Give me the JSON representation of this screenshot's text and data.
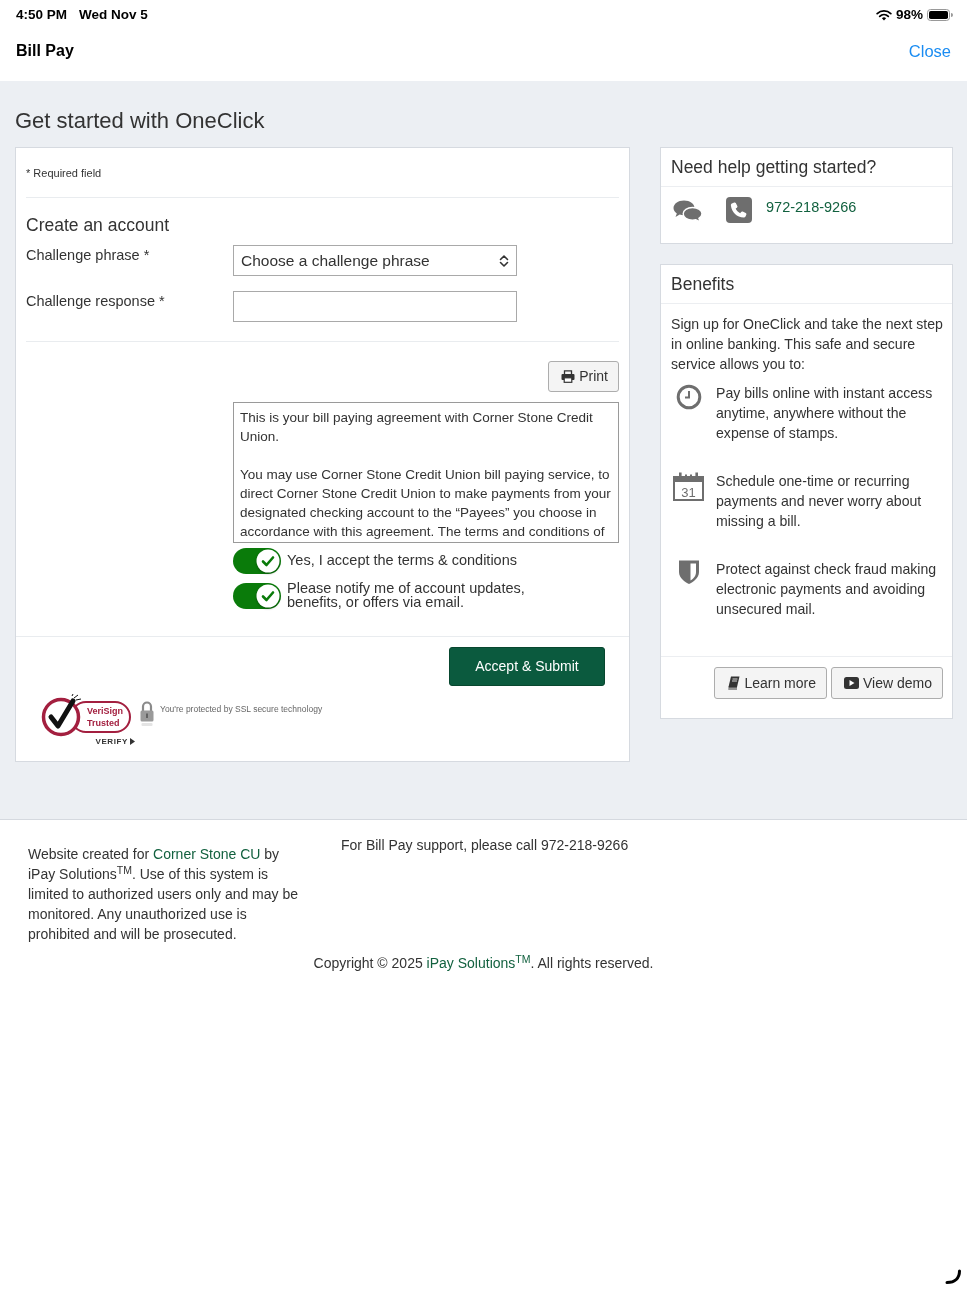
{
  "status_bar": {
    "time": "4:50 PM",
    "date": "Wed Nov 5",
    "battery": "98%"
  },
  "header": {
    "title": "Bill Pay",
    "close": "Close"
  },
  "page_title": "Get started with OneClick",
  "form": {
    "required_note": "* Required field",
    "section_title": "Create an account",
    "fields": [
      {
        "kind": "select",
        "label": "Challenge phrase *",
        "value": "Choose a challenge phrase"
      },
      {
        "kind": "text",
        "label": "Challenge response *"
      }
    ],
    "print_button": "Print",
    "agreement": [
      "This is your bill paying agreement with Corner Stone Credit Union.",
      "You may use Corner Stone Credit Union bill paying service, to direct Corner Stone Credit Union to make payments from your designated checking account to the “Payees” you choose in accordance with this agreement. The terms and conditions of"
    ],
    "toggles": [
      {
        "label": "Yes, I accept the terms & conditions",
        "on": true
      },
      {
        "label": "Please notify me of account updates, benefits, or offers via email.",
        "on": true
      }
    ],
    "submit_button": "Accept & Submit",
    "seal": {
      "brand": "VeriSign",
      "tagline": "Trusted",
      "verify": "VERIFY"
    },
    "ssl_note": "You're protected by SSL secure technology"
  },
  "help": {
    "title": "Need help getting started?",
    "phone": "972-218-9266"
  },
  "benefits": {
    "title": "Benefits",
    "intro": "Sign up for OneClick and take the next step in online banking. This safe and secure service allows you to:",
    "items": [
      {
        "kind": "clock",
        "text": "Pay bills online with instant access anytime, anywhere without the expense of stamps."
      },
      {
        "kind": "calendar",
        "day": "31",
        "text": "Schedule one-time or recurring payments and never worry about missing a bill."
      },
      {
        "kind": "shield",
        "text": "Protect against check fraud making electronic payments and avoiding unsecured mail."
      }
    ],
    "buttons": [
      {
        "kind": "book",
        "label": "Learn more"
      },
      {
        "kind": "play",
        "label": "View demo"
      }
    ]
  },
  "footer": {
    "disclaimer": {
      "before": "Website created for",
      "link": "Corner Stone CU",
      "after": "by iPay Solutions$^{TM}$. Use of this system is limited to authorized users only and may be monitored. Any unauthorized use is prohibited and will be prosecuted."
    },
    "support": "For Bill Pay support, please call 972-218-9266",
    "copyright": {
      "before": "Copyright © 2025",
      "link": "iPay Solutions$^{TM}$",
      "after": ". All rights reserved."
    }
  }
}
